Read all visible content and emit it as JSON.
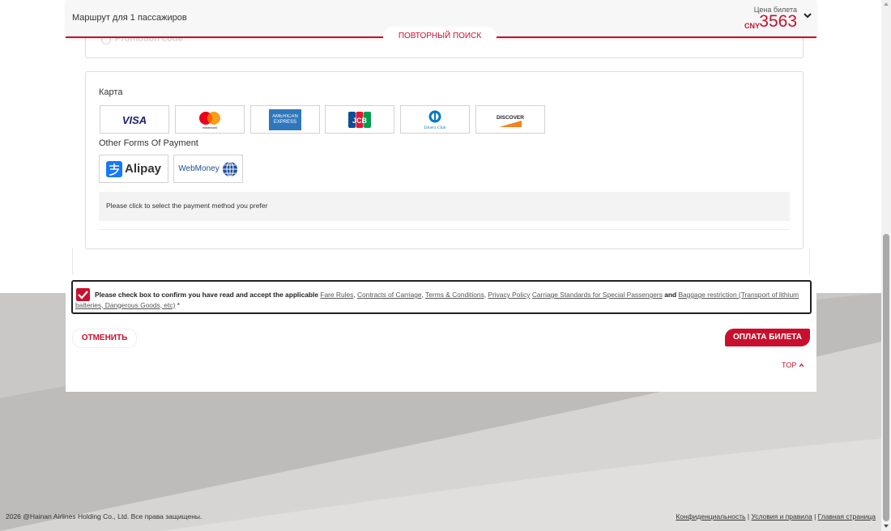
{
  "header": {
    "route": "Маршрут для 1 пассажиров",
    "price_label": "Цена билета",
    "currency": "CNY",
    "price": "3563",
    "research_button": "ПОВТОРНЫЙ ПОИСК"
  },
  "promo": {
    "label": "Promotion code"
  },
  "payment": {
    "card_title": "Карта",
    "cards": [
      "VISA",
      "mastercard",
      "AMERICAN EXPRESS",
      "JCB",
      "Diners Club",
      "DISCOVER"
    ],
    "other_title": "Other Forms Of Payment",
    "others": [
      "Alipay",
      "WebMoney"
    ],
    "hint": "Please click to select the payment method you prefer"
  },
  "consent": {
    "checked": true,
    "prefix": "Please check box to confirm you have read and accept the applicable",
    "fare_rules": "Fare Rules",
    "contracts": "Contracts of Carriage",
    "terms": "Terms & Conditions",
    "privacy": "Privacy Policy",
    "standards": "Carriage Standards for Special Passengers",
    "and": "and",
    "baggage": "Baggage restriction (Transport of lithium batteries, Dangerous Goods, etc)",
    "required": "*"
  },
  "actions": {
    "cancel": "ОТМЕНИТЬ",
    "pay": "ОПЛАТА БИЛЕТА",
    "top": "TOP"
  },
  "footer": {
    "copyright": "2026 @Hainan Airlines Holding Co., Ltd. Все права защищены.",
    "privacy": "Конфиденциальность",
    "terms": "Условия и правила",
    "home": "Главная страница",
    "sep": " | "
  },
  "colors": {
    "brand_red": "#c8102e",
    "gray_bg": "#c9c8c7"
  }
}
